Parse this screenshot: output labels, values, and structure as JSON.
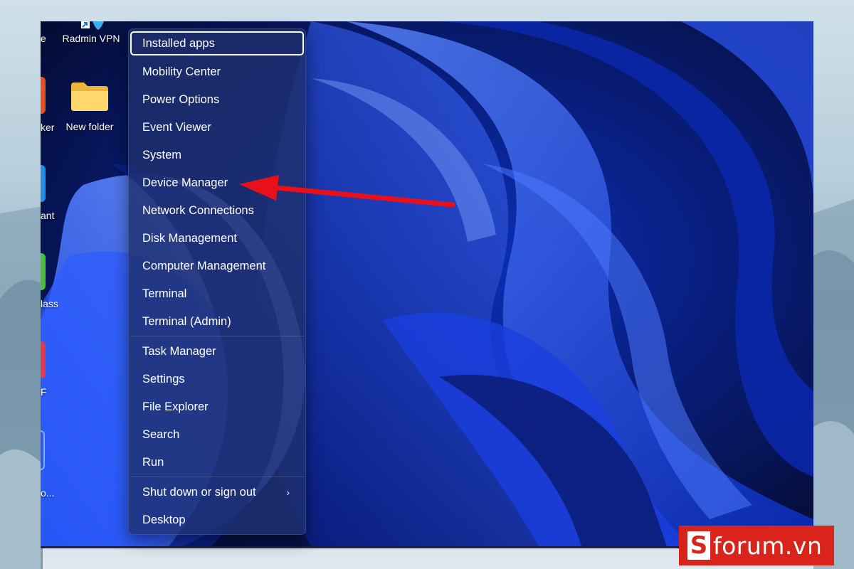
{
  "desktop": {
    "icons": [
      {
        "label": "Radmin VPN",
        "icon": "radmin-vpn-shortcut-icon"
      },
      {
        "label": "New folder",
        "icon": "folder-icon"
      }
    ],
    "partial_labels": [
      "e",
      "ker",
      "ant",
      "lass",
      "F",
      "o..."
    ]
  },
  "context_menu": {
    "items": [
      {
        "label": "Installed apps",
        "focused": true
      },
      {
        "label": "Mobility Center"
      },
      {
        "label": "Power Options"
      },
      {
        "label": "Event Viewer"
      },
      {
        "label": "System"
      },
      {
        "label": "Device Manager",
        "annotated": true
      },
      {
        "label": "Network Connections"
      },
      {
        "label": "Disk Management"
      },
      {
        "label": "Computer Management"
      },
      {
        "label": "Terminal"
      },
      {
        "label": "Terminal (Admin)"
      },
      {
        "label": "Task Manager"
      },
      {
        "label": "Settings"
      },
      {
        "label": "File Explorer"
      },
      {
        "label": "Search"
      },
      {
        "label": "Run"
      },
      {
        "label": "Shut down or sign out",
        "submenu": true
      },
      {
        "label": "Desktop"
      }
    ]
  },
  "annotation": {
    "icon": "red-arrow-icon",
    "color": "#e8101a",
    "target": "Device Manager"
  },
  "watermark": {
    "logo_letter": "S",
    "text": "forum.vn",
    "color": "#d9241c"
  }
}
